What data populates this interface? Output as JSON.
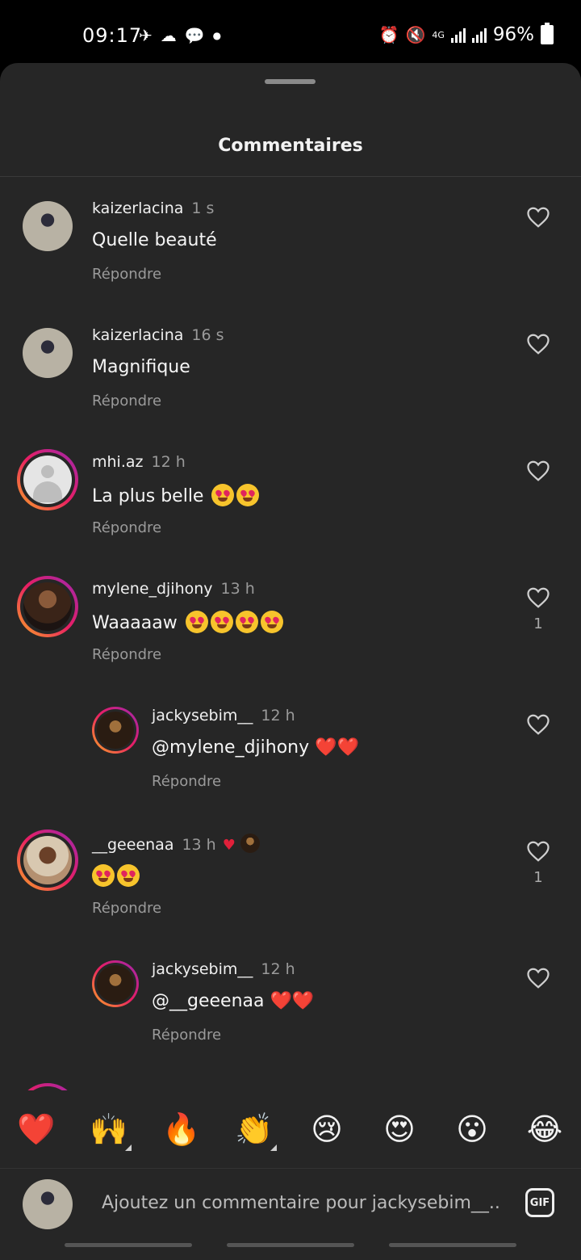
{
  "status_bar": {
    "time": "09:17",
    "network": "4G",
    "battery": "96%"
  },
  "sheet": {
    "title": "Commentaires"
  },
  "comments": [
    {
      "user": "kaizerlacina",
      "time": "1 s",
      "text": "Quelle beauté",
      "emojis": 0,
      "reply": "Répondre",
      "likes": "",
      "indent": false,
      "ring": false
    },
    {
      "user": "kaizerlacina",
      "time": "16 s",
      "text": "Magnifique",
      "emojis": 0,
      "reply": "Répondre",
      "likes": "",
      "indent": false,
      "ring": false
    },
    {
      "user": "mhi.az",
      "time": "12 h",
      "text": "La plus belle",
      "emojis": 2,
      "reply": "Répondre",
      "likes": "",
      "indent": false,
      "ring": true
    },
    {
      "user": "mylene_djihony",
      "time": "13 h",
      "text": "Waaaaaw",
      "emojis": 4,
      "reply": "Répondre",
      "likes": "1",
      "indent": false,
      "ring": true
    },
    {
      "user": "jackysebim__",
      "time": "12 h",
      "text": "@mylene_djihony ❤️❤️",
      "emojis": 0,
      "reply": "Répondre",
      "likes": "",
      "indent": true,
      "ring": true
    },
    {
      "user": "__geeenaa",
      "time": "13 h",
      "text": "",
      "emojis": 2,
      "reply": "Répondre",
      "likes": "1",
      "indent": false,
      "ring": true,
      "liked_by_author": true
    },
    {
      "user": "jackysebim__",
      "time": "12 h",
      "text": "@__geeenaa ❤️❤️",
      "emojis": 0,
      "reply": "Répondre",
      "likes": "",
      "indent": true,
      "ring": true
    }
  ],
  "reactions": [
    "❤️",
    "🙌",
    "🔥",
    "👏",
    "😢",
    "😍",
    "😮",
    "😂"
  ],
  "input": {
    "placeholder": "Ajoutez un commentaire pour jackysebim__...",
    "gif_label": "GIF"
  },
  "colors": {
    "sheet_bg": "#262626",
    "status_bg": "#000000",
    "muted_text": "#9a9a9a",
    "story_ring": "#e91e63"
  }
}
